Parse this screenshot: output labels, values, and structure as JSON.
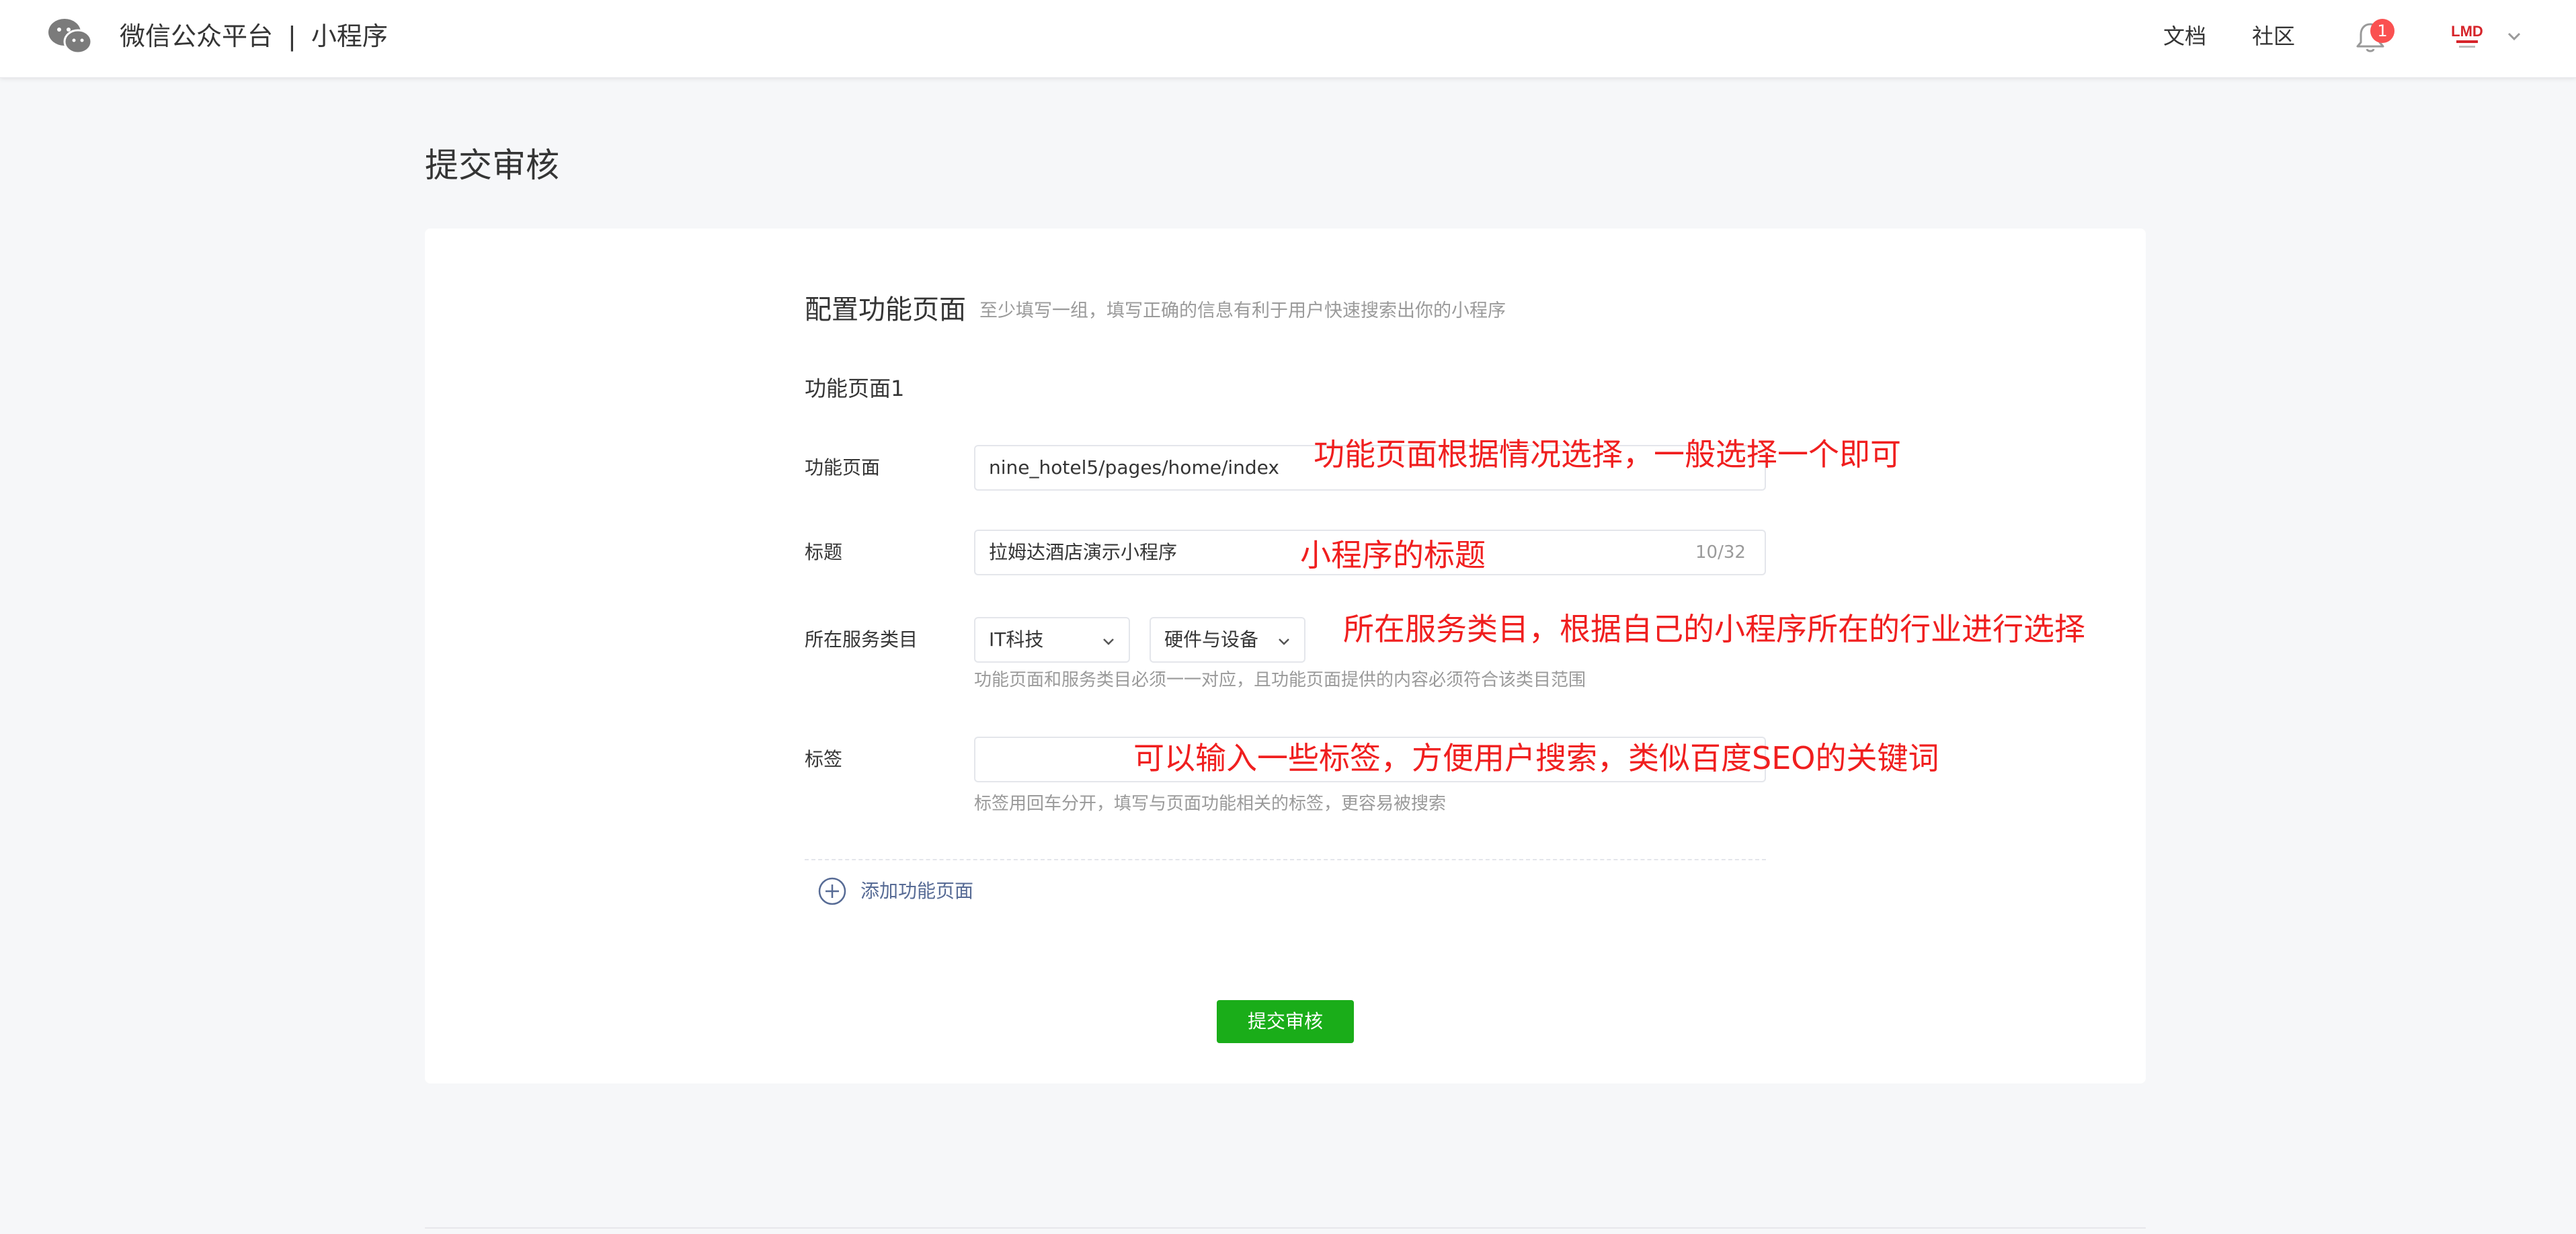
{
  "header": {
    "brand": "微信公众平台",
    "separator": "|",
    "product": "小程序",
    "nav": {
      "docs": "文档",
      "community": "社区"
    },
    "notification_count": "1",
    "avatar_text": "LMD"
  },
  "page": {
    "title": "提交审核"
  },
  "section": {
    "title": "配置功能页面",
    "description": "至少填写一组，填写正确的信息有利于用户快速搜索出你的小程序"
  },
  "group": {
    "title": "功能页面1",
    "page_label": "功能页面",
    "page_value": "nine_hotel5/pages/home/index",
    "title_label": "标题",
    "title_value": "拉姆达酒店演示小程序",
    "title_counter": "10/32",
    "category_label": "所在服务类目",
    "category_primary": "IT科技",
    "category_secondary": "硬件与设备",
    "category_hint": "功能页面和服务类目必须一一对应，且功能页面提供的内容必须符合该类目范围",
    "tags_label": "标签",
    "tags_value": "",
    "tags_hint": "标签用回车分开，填写与页面功能相关的标签，更容易被搜索"
  },
  "actions": {
    "add_page": "添加功能页面",
    "submit": "提交审核"
  },
  "annotations": {
    "page": "功能页面根据情况选择，一般选择一个即可",
    "title": "小程序的标题",
    "category": "所在服务类目，根据自己的小程序所在的行业进行选择",
    "tags": "可以输入一些标签，方便用户搜索，类似百度SEO的关键词"
  },
  "colors": {
    "primary_green": "#1aad19",
    "link_blue": "#576b95",
    "annotation_red": "#f01f1f",
    "badge_red": "#fa5151"
  }
}
